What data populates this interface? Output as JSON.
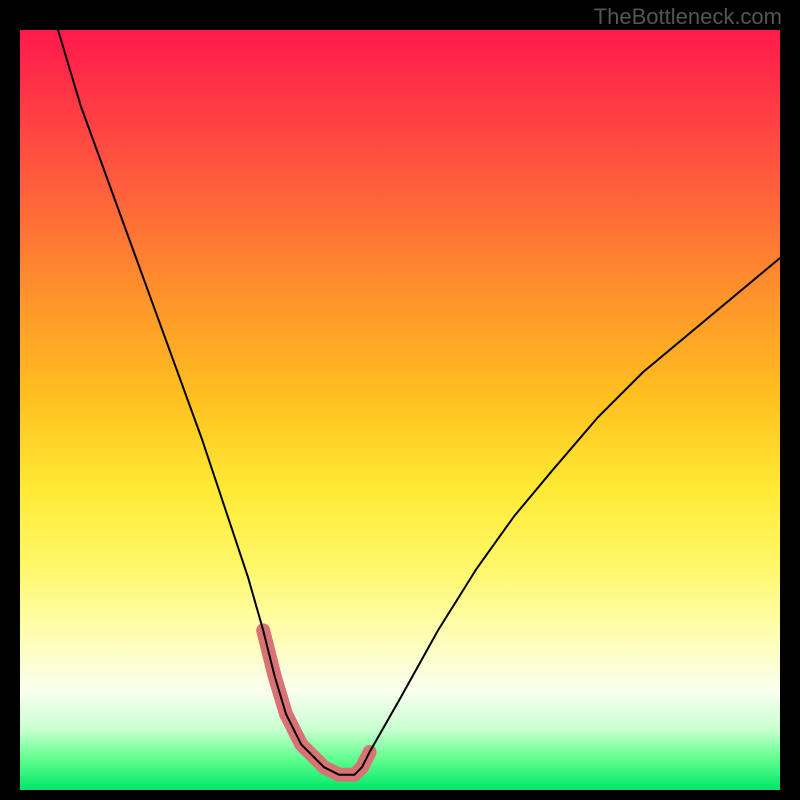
{
  "watermark": "TheBottleneck.com",
  "chart_data": {
    "type": "line",
    "title": "",
    "xlabel": "",
    "ylabel": "",
    "xlim": [
      0,
      100
    ],
    "ylim": [
      0,
      100
    ],
    "grid": false,
    "legend": false,
    "series": [
      {
        "name": "bottleneck-curve",
        "color": "#000000",
        "stroke_width": 2,
        "x": [
          5,
          8,
          12,
          16,
          20,
          24,
          27,
          30,
          32,
          33.5,
          35,
          37,
          40,
          42,
          44,
          45,
          46,
          50,
          55,
          60,
          65,
          70,
          76,
          82,
          88,
          94,
          100
        ],
        "values": [
          100,
          90,
          79,
          68,
          57,
          46,
          37,
          28,
          21,
          15,
          10,
          6,
          3,
          2,
          2,
          3,
          5,
          12,
          21,
          29,
          36,
          42,
          49,
          55,
          60,
          65,
          70
        ]
      },
      {
        "name": "sweet-spot-highlight",
        "color": "#d97373",
        "stroke_width": 14,
        "x": [
          32,
          33.5,
          35,
          37,
          40,
          42,
          44,
          45,
          46
        ],
        "values": [
          21,
          15,
          10,
          6,
          3,
          2,
          2,
          3,
          5
        ]
      }
    ],
    "gradient_stops": [
      {
        "pos": 0,
        "color": "#ff1a4d"
      },
      {
        "pos": 8,
        "color": "#ff3346"
      },
      {
        "pos": 20,
        "color": "#ff5c3d"
      },
      {
        "pos": 33,
        "color": "#ff8c2e"
      },
      {
        "pos": 48,
        "color": "#ffbf1f"
      },
      {
        "pos": 60,
        "color": "#ffe933"
      },
      {
        "pos": 70,
        "color": "#fff766"
      },
      {
        "pos": 78,
        "color": "#fffda6"
      },
      {
        "pos": 87,
        "color": "#fafff0"
      },
      {
        "pos": 92,
        "color": "#c9ffd1"
      },
      {
        "pos": 96,
        "color": "#5eff8c"
      },
      {
        "pos": 100,
        "color": "#00e66b"
      }
    ]
  }
}
